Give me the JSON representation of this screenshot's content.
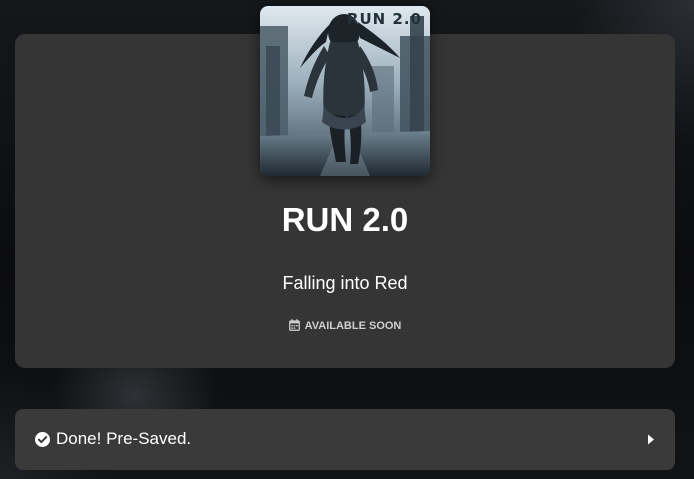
{
  "release": {
    "cover_text": "RUN 2.0",
    "title": "RUN 2.0",
    "subtitle": "Falling into Red",
    "status_icon": "calendar-icon",
    "status_text": "AVAILABLE SOON"
  },
  "presave": {
    "icon": "check-circle-icon",
    "label": "Done! Pre-Saved.",
    "action_icon": "chevron-right-icon"
  },
  "colors": {
    "card_background": "#353535",
    "bar_background": "#3a3a3a",
    "text": "#ffffff",
    "status_text": "#cfcfcf"
  }
}
